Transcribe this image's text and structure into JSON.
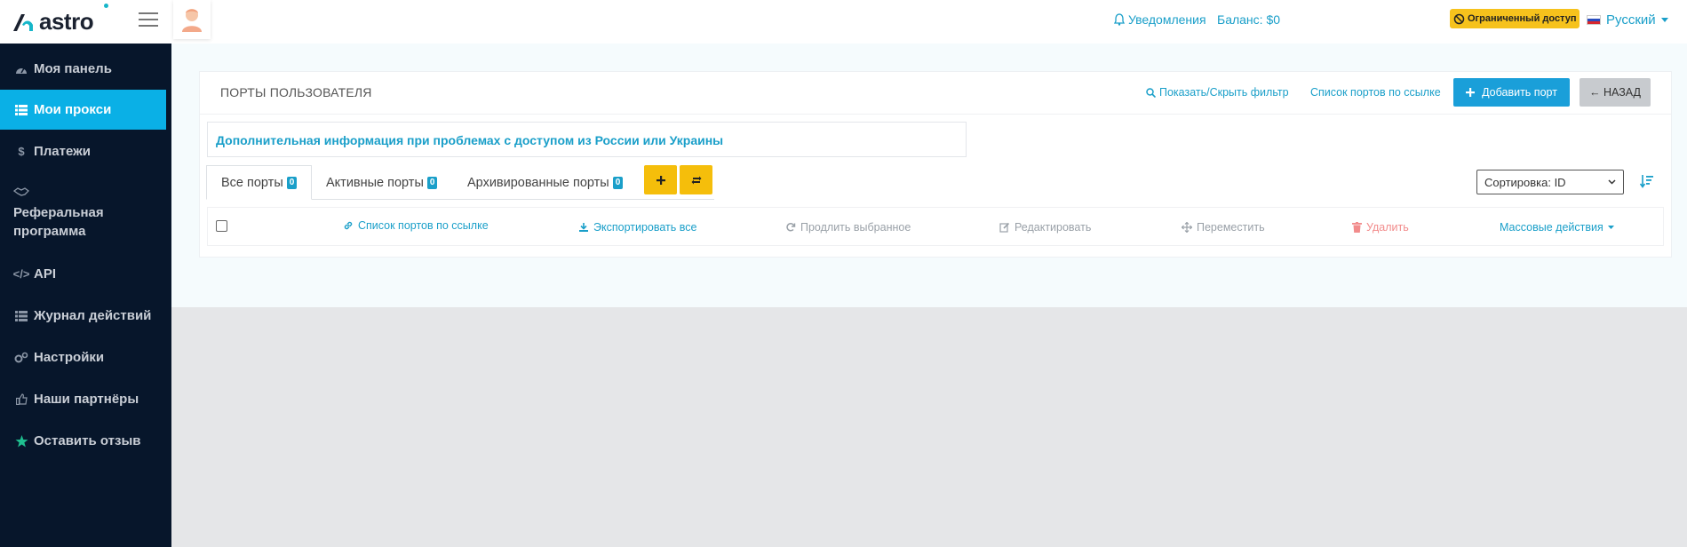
{
  "header": {
    "logo_text": "astro",
    "notifications_label": "Уведомления",
    "balance_label": "Баланс: $0",
    "restricted_label": "Ограниченный доступ",
    "language_label": "Русский"
  },
  "sidebar": {
    "items": [
      {
        "label": "Моя панель",
        "icon": "dashboard-icon"
      },
      {
        "label": "Мои прокси",
        "icon": "list-icon",
        "active": true
      },
      {
        "label": "Платежи",
        "icon": "dollar-icon"
      },
      {
        "label": "Реферальная программа",
        "icon": "handshake-icon"
      },
      {
        "label": "API",
        "icon": "code-icon"
      },
      {
        "label": "Журнал действий",
        "icon": "list-icon"
      },
      {
        "label": "Настройки",
        "icon": "gears-icon"
      },
      {
        "label": "Наши партнёры",
        "icon": "thumbs-up-icon"
      },
      {
        "label": "Оставить отзыв",
        "icon": "star-icon"
      }
    ]
  },
  "panel": {
    "title": "ПОРТЫ ПОЛЬЗОВАТЕЛЯ",
    "filter_toggle_label": "Показать/Скрыть фильтр",
    "ports_by_link_label": "Список портов по ссылке",
    "add_port_label": "Добавить порт",
    "back_label": "← НАЗАД",
    "info_link": "Дополнительная информация при проблемах с доступом из России или Украины"
  },
  "tabs": [
    {
      "label": "Все порты",
      "count": "0",
      "active": true
    },
    {
      "label": "Активные порты",
      "count": "0"
    },
    {
      "label": "Архивированные порты",
      "count": "0"
    }
  ],
  "sort": {
    "selected": "Сортировка: ID"
  },
  "actions": {
    "ports_by_link": "Список портов по ссылке",
    "export_all": "Экспортировать все",
    "renew_selected": "Продлить выбранное",
    "edit": "Редактировать",
    "move": "Переместить",
    "delete": "Удалить",
    "bulk_actions": "Массовые действия"
  },
  "colors": {
    "sidebar_bg": "#07162b",
    "accent": "#0ab0e6",
    "link": "#1a9fc9",
    "warning": "#f5be0b",
    "danger": "#f28c8c"
  }
}
